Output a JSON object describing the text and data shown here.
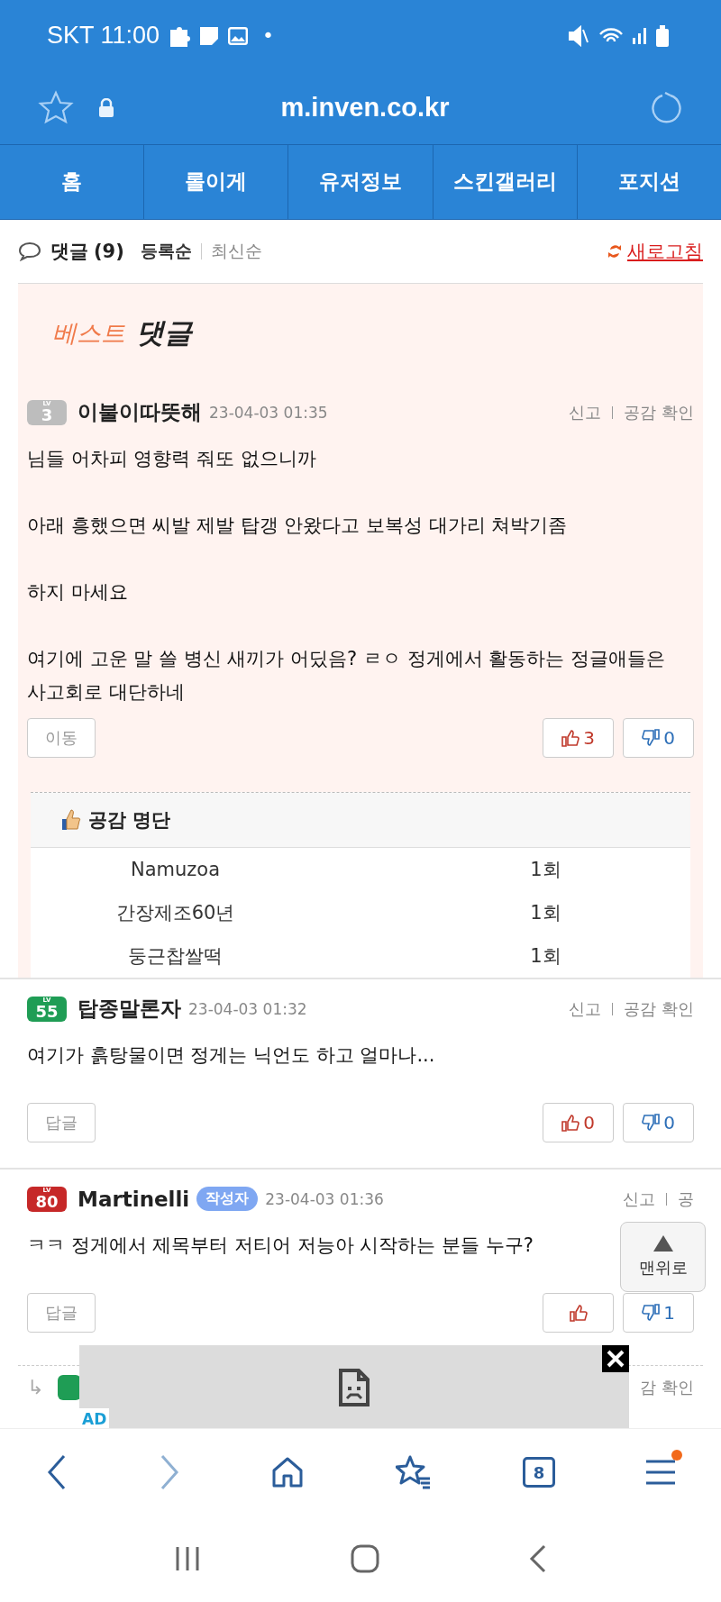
{
  "status_bar": {
    "carrier_time": "SKT 11:00",
    "dot": "•"
  },
  "url_bar": {
    "url": "m.inven.co.kr"
  },
  "nav_tabs": [
    {
      "label": "홈"
    },
    {
      "label": "롤이게"
    },
    {
      "label": "유저정보"
    },
    {
      "label": "스킨갤러리"
    },
    {
      "label": "포지션"
    }
  ],
  "comments_header": {
    "title": "댓글",
    "count": "(9)",
    "sort": [
      {
        "label": "등록순",
        "selected": true
      },
      {
        "label": "최신순",
        "selected": false
      }
    ],
    "refresh": "새로고침"
  },
  "best": {
    "title_a": "베스트",
    "title_b": "댓글",
    "comment": {
      "level_label": "LV",
      "level": "3",
      "color": "#bdbdbd",
      "name": "이불이따뜻해",
      "date": "23-04-03 01:35",
      "report": "신고",
      "confirm": "공감 확인",
      "body": [
        "님들 어차피 영향력 줘또 없으니까",
        "아래 흥했으면 씨발 제발 탑갱 안왔다고 보복성 대가리 쳐박기좀",
        "하지 마세요",
        "여기에 고운 말 쓸 병신 새끼가 어딨음? ㄹㅇ 정게에서 활동하는 정글애들은 사고회로 대단하네"
      ],
      "action": "이동",
      "likes": "3",
      "dislikes": "0"
    },
    "likes_list": {
      "title": "공감 명단",
      "rows": [
        {
          "name": "Namuzoa",
          "count": "1회"
        },
        {
          "name": "간장제조60년",
          "count": "1회"
        },
        {
          "name": "둥근찹쌀떡",
          "count": "1회"
        }
      ]
    }
  },
  "comments": [
    {
      "level_label": "LV",
      "level": "55",
      "color": "#1f9d55",
      "name": "탑종말론자",
      "date": "23-04-03 01:32",
      "report": "신고",
      "confirm": "공감 확인",
      "body": [
        "여기가 흙탕물이면 정게는 닉언도 하고 얼마나..."
      ],
      "action": "답글",
      "likes": "0",
      "dislikes": "0"
    },
    {
      "level_label": "LV",
      "level": "80",
      "color": "#c62828",
      "name": "Martinelli",
      "author_badge": "작성자",
      "date": "23-04-03 01:36",
      "report": "신고",
      "confirm": "공",
      "body": [
        "ㅋㅋ 정게에서 제목부터 저티어 저능아 시작하는 분들 누구?"
      ],
      "action": "답글",
      "dislikes": "1"
    }
  ],
  "reply_row": {
    "arrow": "↳",
    "confirm": "감 확인"
  },
  "ad": {
    "label": "AD"
  },
  "scroll_top": {
    "label": "맨위로"
  },
  "browser_bar": {
    "tabs_count": "8",
    "menu_badge": true
  }
}
